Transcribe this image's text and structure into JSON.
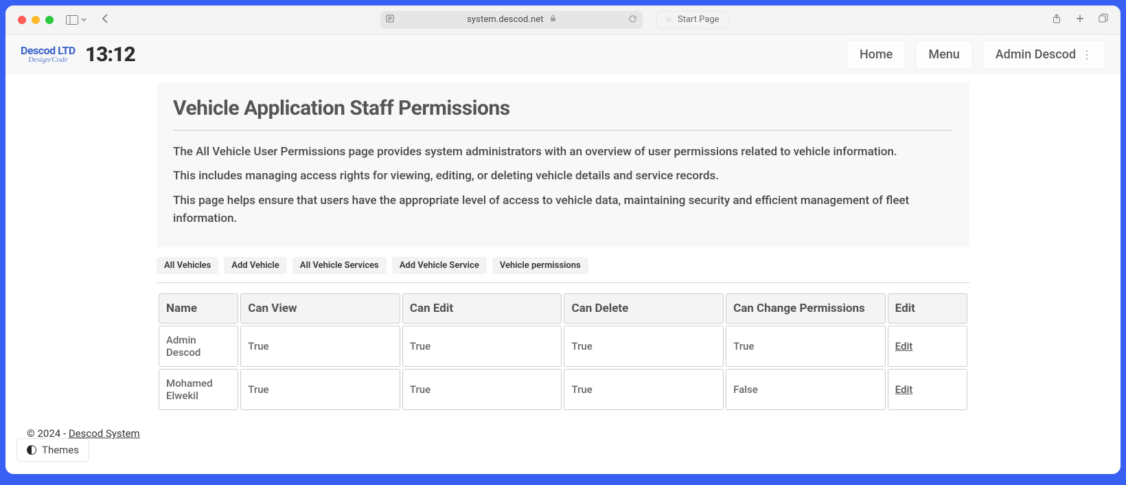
{
  "browser": {
    "url": "system.descod.net",
    "bookmark_label": "Start Page"
  },
  "header": {
    "brand_title": "Descod LTD",
    "brand_sub": "Design/Code",
    "clock": "13:12",
    "nav": {
      "home": "Home",
      "menu": "Menu",
      "user": "Admin Descod"
    }
  },
  "card": {
    "title": "Vehicle Application Staff Permissions",
    "p1": "The All Vehicle User Permissions page provides system administrators with an overview of user permissions related to vehicle information.",
    "p2": "This includes managing access rights for viewing, editing, or deleting vehicle details and service records.",
    "p3": "This page helps ensure that users have the appropriate level of access to vehicle data, maintaining security and efficient management of fleet information."
  },
  "tabs": {
    "all_vehicles": "All Vehicles",
    "add_vehicle": "Add Vehicle",
    "all_services": "All Vehicle Services",
    "add_service": "Add Vehicle Service",
    "permissions": "Vehicle permissions"
  },
  "table": {
    "headers": {
      "name": "Name",
      "view": "Can View",
      "edit": "Can Edit",
      "delete": "Can Delete",
      "change": "Can Change Permissions",
      "action": "Edit"
    },
    "rows": [
      {
        "name": "Admin Descod",
        "view": "True",
        "edit": "True",
        "delete": "True",
        "change": "True",
        "action": "Edit"
      },
      {
        "name": "Mohamed Elwekil",
        "view": "True",
        "edit": "True",
        "delete": "True",
        "change": "False",
        "action": "Edit"
      }
    ]
  },
  "footer": {
    "prefix": "© 2024 - ",
    "link": "Descod System"
  },
  "themes_label": "Themes"
}
